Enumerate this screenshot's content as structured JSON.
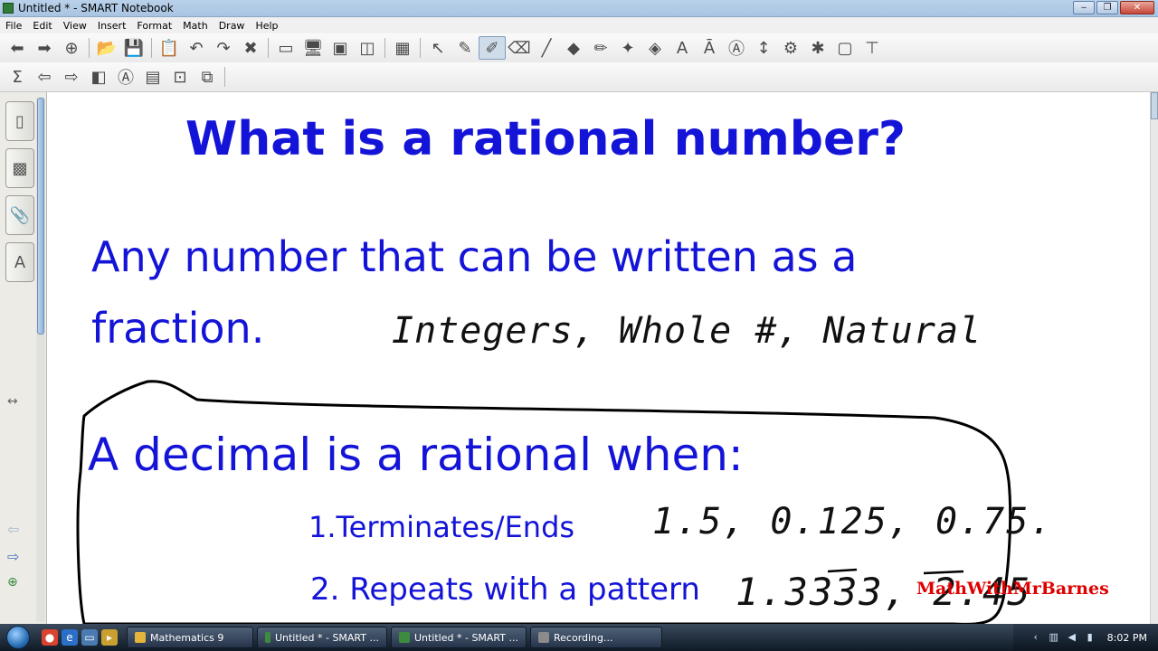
{
  "window": {
    "title": "Untitled * - SMART Notebook",
    "controls": [
      "minimize",
      "maximize",
      "close"
    ]
  },
  "menu": [
    "File",
    "Edit",
    "View",
    "Insert",
    "Format",
    "Math",
    "Draw",
    "Help"
  ],
  "toolbar_row1": [
    {
      "icon": "back-arrow-icon",
      "glyph": "⬅"
    },
    {
      "icon": "forward-arrow-icon",
      "glyph": "➡"
    },
    {
      "icon": "add-page-icon",
      "glyph": "⊕"
    },
    {
      "icon": "open-folder-icon",
      "glyph": "📂"
    },
    {
      "icon": "save-icon",
      "glyph": "💾"
    },
    {
      "icon": "paste-icon",
      "glyph": "📋"
    },
    {
      "icon": "undo-icon",
      "glyph": "↶"
    },
    {
      "icon": "redo-icon",
      "glyph": "↷"
    },
    {
      "icon": "delete-icon",
      "glyph": "✖"
    },
    {
      "icon": "screen-shade-icon",
      "glyph": "▭"
    },
    {
      "icon": "full-screen-icon",
      "glyph": "🖥"
    },
    {
      "icon": "transparent-background-icon",
      "glyph": "▣"
    },
    {
      "icon": "dual-page-icon",
      "glyph": "◫"
    },
    {
      "icon": "table-icon",
      "glyph": "▦"
    },
    {
      "icon": "select-arrow-icon",
      "glyph": "↖"
    },
    {
      "icon": "pen-icon",
      "glyph": "✎"
    },
    {
      "icon": "highlighter-icon",
      "glyph": "✐",
      "active": true
    },
    {
      "icon": "eraser-icon",
      "glyph": "⌫"
    },
    {
      "icon": "line-icon",
      "glyph": "╱"
    },
    {
      "icon": "shapes-icon",
      "glyph": "◆"
    },
    {
      "icon": "creative-pen-icon",
      "glyph": "✏"
    },
    {
      "icon": "magic-pen-icon",
      "glyph": "✦"
    },
    {
      "icon": "fill-icon",
      "glyph": "◈"
    },
    {
      "icon": "text-icon",
      "glyph": "A"
    },
    {
      "icon": "text-style-icon",
      "glyph": "Ā"
    },
    {
      "icon": "shape-recognition-icon",
      "glyph": "Ⓐ"
    },
    {
      "icon": "move-toolbar-icon",
      "glyph": "↕"
    },
    {
      "icon": "properties-icon",
      "glyph": "⚙"
    },
    {
      "icon": "settings-icon",
      "glyph": "✱"
    },
    {
      "icon": "screen-capture-icon",
      "glyph": "▢"
    },
    {
      "icon": "measurement-tools-icon",
      "glyph": "⊤"
    }
  ],
  "toolbar_row2": [
    {
      "icon": "sum-icon",
      "glyph": "Σ"
    },
    {
      "icon": "previous-page-icon",
      "glyph": "⇦"
    },
    {
      "icon": "next-page-icon",
      "glyph": "⇨"
    },
    {
      "icon": "eraser-small-icon",
      "glyph": "◧"
    },
    {
      "icon": "handwriting-recognition-icon",
      "glyph": "Ⓐ"
    },
    {
      "icon": "table-format-icon",
      "glyph": "▤"
    },
    {
      "icon": "graph-icon",
      "glyph": "⊡"
    },
    {
      "icon": "insert-object-icon",
      "glyph": "⧉"
    }
  ],
  "side_tabs": [
    {
      "name": "page-sorter-tab",
      "icon": "page-icon",
      "glyph": "▯"
    },
    {
      "name": "gallery-tab",
      "icon": "gallery-image-icon",
      "glyph": "▩"
    },
    {
      "name": "attachments-tab",
      "icon": "paperclip-icon",
      "glyph": "📎"
    },
    {
      "name": "properties-tab",
      "icon": "properties-tab-icon",
      "glyph": "A"
    }
  ],
  "slide": {
    "title": "What is a rational number?",
    "definition": "Any number that can be written as a fraction.",
    "handwriting_types": "Integers, Whole #, Natural",
    "decimal_heading": "A decimal is a rational when:",
    "item_1": "1.Terminates/Ends",
    "item_2": "2. Repeats with a pattern",
    "hw_terminating": "1.5,  0.125,  0.75.",
    "hw_repeating": "1.3333, 2.45",
    "watermark": "MathWithMrBarnes"
  },
  "taskbar": {
    "items": [
      {
        "label": "Mathematics 9",
        "color": "#e5b53b"
      },
      {
        "label": "Untitled * - SMART ...",
        "color": "#3d8b3f"
      },
      {
        "label": "Untitled * - SMART ...",
        "color": "#3d8b3f"
      },
      {
        "label": "Recording...",
        "color": "#8b8b8b"
      }
    ],
    "clock": "8:02 PM"
  },
  "colors": {
    "slide_text": "#1414d8",
    "handwriting": "#111111",
    "watermark": "#e00000"
  }
}
